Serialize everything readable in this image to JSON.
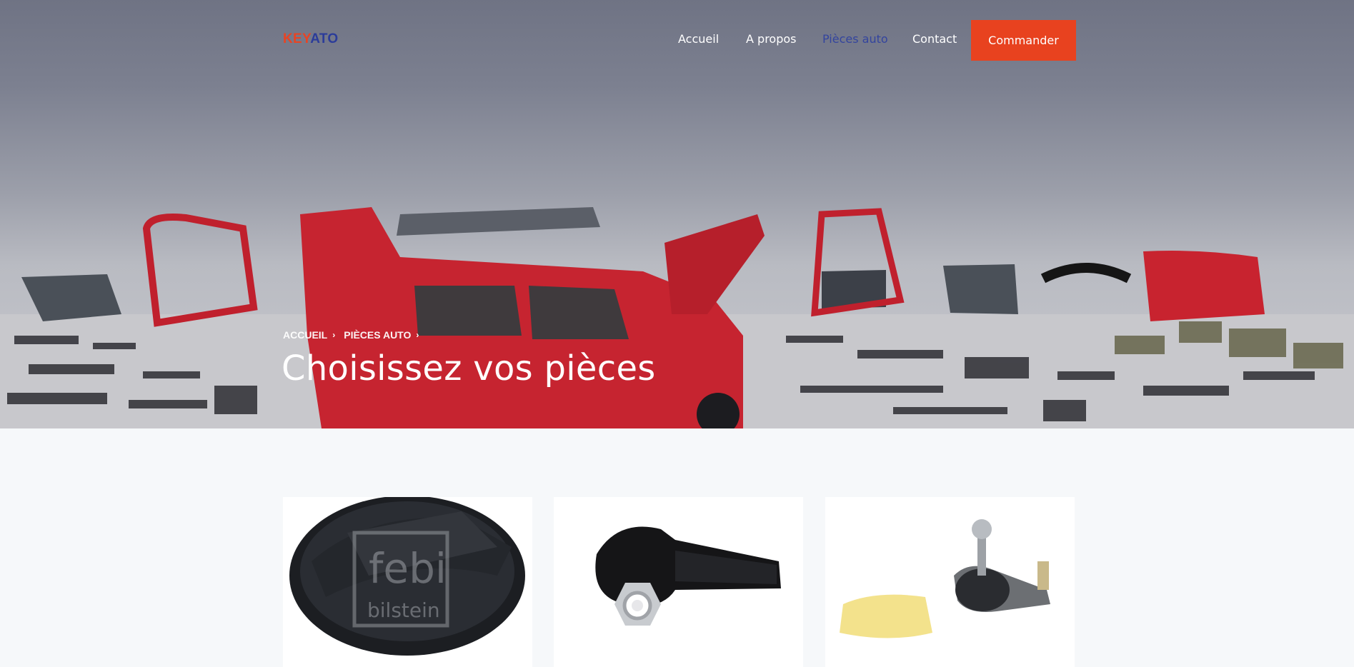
{
  "brand": {
    "logo_part1": "KEY",
    "logo_part2": "ATO"
  },
  "nav": {
    "items": [
      {
        "label": "Accueil"
      },
      {
        "label": "A propos"
      },
      {
        "label": "Pièces auto",
        "active": true
      },
      {
        "label": "Contact"
      }
    ],
    "cta_label": "Commander"
  },
  "hero": {
    "breadcrumb": [
      "ACCUEIL",
      "PIÈCES AUTO"
    ],
    "title": "Choisissez vos pièces"
  },
  "products": [
    {
      "image": "fuel-cap-febi-bilstein",
      "watermark_line1": "febi",
      "watermark_line2": "bilstein"
    },
    {
      "image": "tie-rod-end"
    },
    {
      "image": "tie-rod-end-with-grease"
    }
  ],
  "colors": {
    "accent": "#e8421f",
    "brand_blue": "#33449e",
    "page_bg": "#f6f8fa"
  }
}
